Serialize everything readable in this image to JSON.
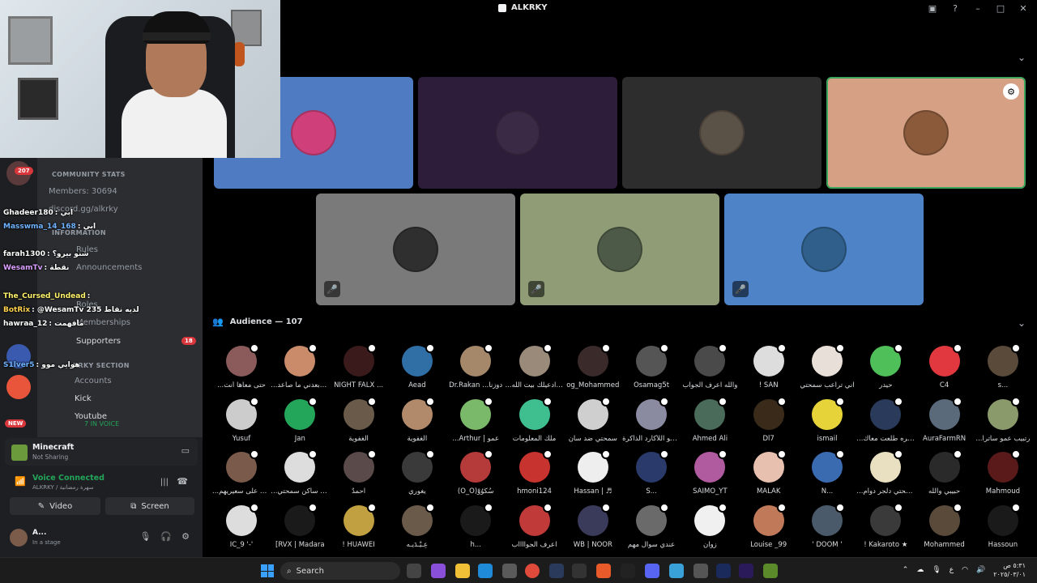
{
  "window": {
    "title": "ALKRKY"
  },
  "sidebar": {
    "categories": [
      "COMMUNITY STATS",
      "INFORMATION",
      "KRKY SECTION"
    ],
    "channels": [
      {
        "label": "Members: 30694"
      },
      {
        "label": "discord.gg/alkrky"
      },
      {
        "label": "Announcements"
      },
      {
        "label": "Rules"
      },
      {
        "label": "Roles"
      },
      {
        "label": "Memberships"
      },
      {
        "label": "Supporters",
        "badge": "18"
      },
      {
        "label": "Accounts"
      },
      {
        "label": "Kick"
      },
      {
        "label": "Youtube"
      }
    ],
    "server_badges": [
      "207",
      "NEW"
    ],
    "in_voice": "7 IN VOICE"
  },
  "chat": [
    {
      "nick": "Ghadeer180",
      "color": "#ffffff",
      "msg": ": ابي"
    },
    {
      "nick": "Masswma_14_168",
      "color": "#6fb3ff",
      "msg": ": ابي"
    },
    {
      "nick": "farah1300",
      "color": "#ffffff",
      "msg": ": شنو بيرو؟"
    },
    {
      "nick": "WesamTv",
      "color": "#d9a0ff",
      "msg": ": نقطة"
    },
    {
      "nick": "The_Cursed_Undead",
      "color": "#fff36b",
      "msg": ":"
    },
    {
      "nick": "BotRix",
      "color": "#ffd24d",
      "msg": ": @WesamTv 235 لديه نقاط"
    },
    {
      "nick": "hawraa_12",
      "color": "#ffffff",
      "msg": ": مافهمت"
    },
    {
      "nick": "S1lver5",
      "color": "#6fb3ff",
      "msg": ": هوايي موو"
    }
  ],
  "stage": {
    "tiles_top": [
      {
        "color": "#4e7bc1",
        "avatar": "#cf3f79"
      },
      {
        "color": "#2e1d3a",
        "avatar": "#3b2a45"
      },
      {
        "color": "#2d2d2d",
        "avatar": "#5a5147"
      },
      {
        "color": "#d6a085",
        "avatar": "#8a5a3b",
        "mod": true
      }
    ],
    "tiles_bottom": [
      {
        "color": "#7a7a7a",
        "avatar": "#2f2f2f"
      },
      {
        "color": "#8f9c76",
        "avatar": "#4e5a48"
      },
      {
        "color": "#4e83c8",
        "avatar": "#2f5f8a"
      }
    ]
  },
  "audience": {
    "header": "Audience — 107",
    "members": [
      {
        "name": "...حتى معاها أنت",
        "color": "#8b5a5a"
      },
      {
        "name": "...م وبعدني ما صاعد",
        "color": "#c98b6a"
      },
      {
        "name": "NIGHT FALX ...",
        "color": "#3a1a1a"
      },
      {
        "name": "Aead",
        "color": "#2f6fa5"
      },
      {
        "name": "Dr.Rakan ...دوزنا",
        "color": "#a5876a"
      },
      {
        "name": "...والله ادعيلك بيت الله",
        "color": "#9a8a7a"
      },
      {
        "name": "og_Mohammed",
        "color": "#3a2a2a"
      },
      {
        "name": "Osamag5t",
        "color": "#555555"
      },
      {
        "name": "والله اعرف الجواب",
        "color": "#4a4a4a"
      },
      {
        "name": "! SAN",
        "color": "#dddddd"
      },
      {
        "name": "اني تراعب سمحتي",
        "color": "#e8e0d8"
      },
      {
        "name": "حيدر",
        "color": "#4fbf5a"
      },
      {
        "name": "C4",
        "color": "#e0383e"
      },
      {
        "name": "s...",
        "color": "#5a4a3a"
      },
      {
        "name": "Yusuf",
        "color": "#cccccc"
      },
      {
        "name": "Jan",
        "color": "#23a55a"
      },
      {
        "name": "الغفوية",
        "color": "#6a5a4a"
      },
      {
        "name": "الغفوية",
        "color": "#b08a6a"
      },
      {
        "name": "...Arthur | عمو",
        "color": "#7ab86a"
      },
      {
        "name": "ملك المعلومات",
        "color": "#3fbf8f"
      },
      {
        "name": "سمحتي ضد سان",
        "color": "#cfcfcf"
      },
      {
        "name": "اني هو اللأكارد الذاكرة",
        "color": "#8a8aa0"
      },
      {
        "name": "Ahmed Ali",
        "color": "#4a6a5a"
      },
      {
        "name": "Dl7",
        "color": "#3a2a1a"
      },
      {
        "name": "ismail",
        "color": "#e6d33a"
      },
      {
        "name": "...لا مره طلعت معاك",
        "color": "#2a3a5a"
      },
      {
        "name": "AuraFarmRN",
        "color": "#5a6a7a"
      },
      {
        "name": "...رتبيب عمو ساترا",
        "color": "#8a9a6a"
      },
      {
        "name": "...يزهم على سعيريهم",
        "color": "#7a5a4a"
      },
      {
        "name": "...الب ساكن سمحتي",
        "color": "#dddddd"
      },
      {
        "name": "احمدٌ",
        "color": "#5a4a4a"
      },
      {
        "name": "يغوري",
        "color": "#3a3a3a"
      },
      {
        "name": "(O_O)سُكُوُوْ",
        "color": "#b53a3a"
      },
      {
        "name": "hmoni124",
        "color": "#c7332f"
      },
      {
        "name": "Hassan | ♬",
        "color": "#eeeeee"
      },
      {
        "name": "S...",
        "color": "#2a3a6a"
      },
      {
        "name": "SAIMO_YT",
        "color": "#b05aa0"
      },
      {
        "name": "MALAK",
        "color": "#e8c0b0"
      },
      {
        "name": "N...",
        "color": "#3a6ab0"
      },
      {
        "name": "...سمحتي دلجر دوام",
        "color": "#e8e0c0"
      },
      {
        "name": "حبيبي والله",
        "color": "#2a2a2a"
      },
      {
        "name": "Mahmoud",
        "color": "#5a1a1a"
      },
      {
        "name": "IC_9 '-'",
        "color": "#dddddd"
      },
      {
        "name": "[RVX | Madara",
        "color": "#1a1a1a"
      },
      {
        "name": "! HUAWEI",
        "color": "#c0a040"
      },
      {
        "name": "عِـيْـدَيـه",
        "color": "#6a5a4a"
      },
      {
        "name": "h...",
        "color": "#1a1a1a"
      },
      {
        "name": "اعرف الجوااااب",
        "color": "#c03a3a"
      },
      {
        "name": "WB | NOOR",
        "color": "#3a3a5a"
      },
      {
        "name": "عندي سوال مهم",
        "color": "#6a6a6a"
      },
      {
        "name": "زوان",
        "color": "#f0f0f0"
      },
      {
        "name": "Louise _99",
        "color": "#c07a5a"
      },
      {
        "name": "' DOOM '",
        "color": "#4a5a6a"
      },
      {
        "name": "! Kakaroto ★",
        "color": "#3a3a3a"
      },
      {
        "name": "Mohammed",
        "color": "#5a4a3a"
      },
      {
        "name": "Hassoun",
        "color": "#1a1a1a"
      }
    ]
  },
  "activity": {
    "title": "Minecraft",
    "subtitle": "Not Sharing"
  },
  "voice": {
    "status": "Voice Connected",
    "location": "ALKRKY / سهرة رمضانية",
    "video_label": "Video",
    "screen_label": "Screen"
  },
  "user": {
    "name": "A...",
    "status": "In a stage"
  },
  "taskbar": {
    "search_placeholder": "Search",
    "clock_time": "٥:٣١ ص",
    "clock_date": "٢٠٢٥/٠٣/٠١",
    "lang": "ع"
  }
}
